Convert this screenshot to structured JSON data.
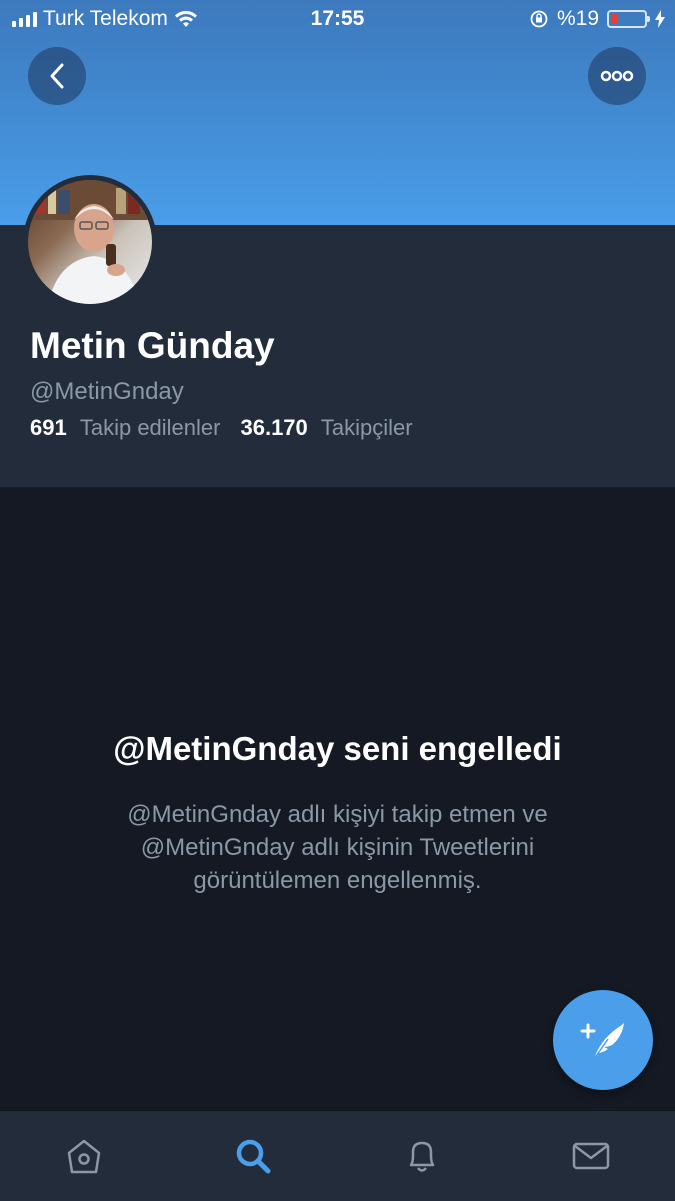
{
  "status_bar": {
    "carrier": "Turk Telekom",
    "time": "17:55",
    "battery_percent": "%19",
    "battery_level": 0.19
  },
  "header": {
    "back_icon": "chevron-left-icon",
    "more_icon": "more-horizontal-icon"
  },
  "profile": {
    "name": "Metin Günday",
    "handle": "@MetinGnday",
    "following_count": "691",
    "following_label": "Takip edilenler",
    "followers_count": "36.170",
    "followers_label": "Takipçiler"
  },
  "blocked": {
    "title": "@MetinGnday seni engelledi",
    "description": "@MetinGnday adlı kişiyi takip etmen ve @MetinGnday adlı kişinin Tweetlerini görüntülemen engellenmiş."
  },
  "tabs": [
    {
      "icon": "home-icon",
      "active": false
    },
    {
      "icon": "search-icon",
      "active": true
    },
    {
      "icon": "bell-icon",
      "active": false
    },
    {
      "icon": "mail-icon",
      "active": false
    }
  ],
  "colors": {
    "accent": "#4a9eea",
    "background": "#141923",
    "panel": "#232c3b",
    "muted_text": "#8b98a6",
    "battery_low": "#f23b30"
  }
}
